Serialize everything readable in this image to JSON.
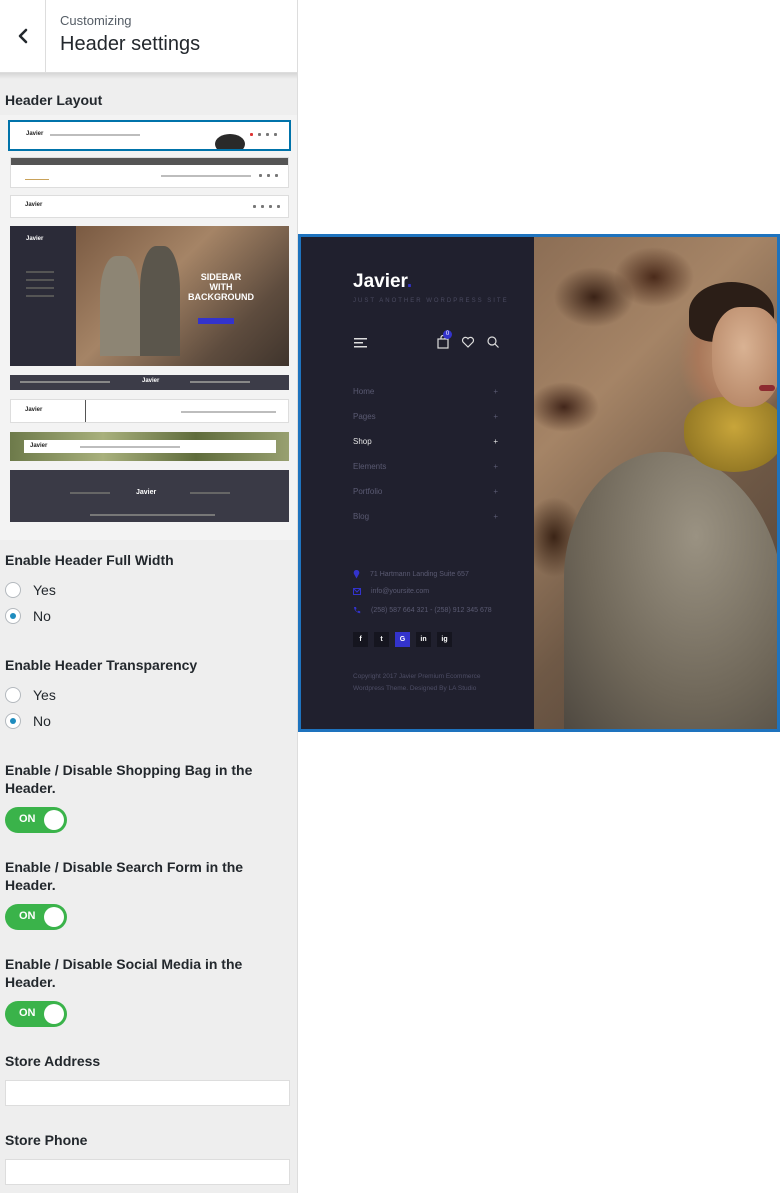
{
  "header": {
    "subtitle": "Customizing",
    "title": "Header settings"
  },
  "sections": {
    "header_layout": "Header Layout",
    "full_width": {
      "label": "Enable Header Full Width",
      "options": [
        "Yes",
        "No"
      ],
      "selected": "No"
    },
    "transparency": {
      "label": "Enable Header Transparency",
      "options": [
        "Yes",
        "No"
      ],
      "selected": "No"
    },
    "shopping_bag": {
      "label": "Enable / Disable Shopping Bag in the Header.",
      "state": "ON"
    },
    "search_form": {
      "label": "Enable / Disable Search Form in the Header.",
      "state": "ON"
    },
    "social_media": {
      "label": "Enable / Disable Social Media in the Header.",
      "state": "ON"
    },
    "store_address": {
      "label": "Store Address",
      "value": ""
    },
    "store_phone": {
      "label": "Store Phone",
      "value": ""
    }
  },
  "layout_thumbs": {
    "logo": "Javier",
    "sidebar_banner_line1": "SIDEBAR",
    "sidebar_banner_line2": "WITH",
    "sidebar_banner_line3": "BACKGROUND"
  },
  "preview": {
    "logo": "Javier",
    "logo_dot": ".",
    "tagline": "JUST ANOTHER WORDPRESS SITE",
    "cart_count": "0",
    "menu": [
      {
        "label": "Home",
        "sign": "+"
      },
      {
        "label": "Pages",
        "sign": "+"
      },
      {
        "label": "Shop",
        "sign": "+"
      },
      {
        "label": "Elements",
        "sign": "+"
      },
      {
        "label": "Portfolio",
        "sign": "+"
      },
      {
        "label": "Blog",
        "sign": "+"
      }
    ],
    "address": "71 Hartmann Landing Suite 657",
    "email": "info@yoursite.com",
    "phone": "(258) 587 664 321 - (258) 912 345 678",
    "social": [
      "f",
      "t",
      "G",
      "in",
      "ig"
    ],
    "copyright_line1": "Copyright 2017 Javier Premium Ecommerce",
    "copyright_line2": "Wordpress Theme. Designed By LA Studio"
  },
  "colors": {
    "toggle_on": "#3ab34a",
    "accent": "#0073aa",
    "preview_border": "#1e73be",
    "preview_sidebar": "#20202e",
    "brand_dot": "#3333cc"
  }
}
